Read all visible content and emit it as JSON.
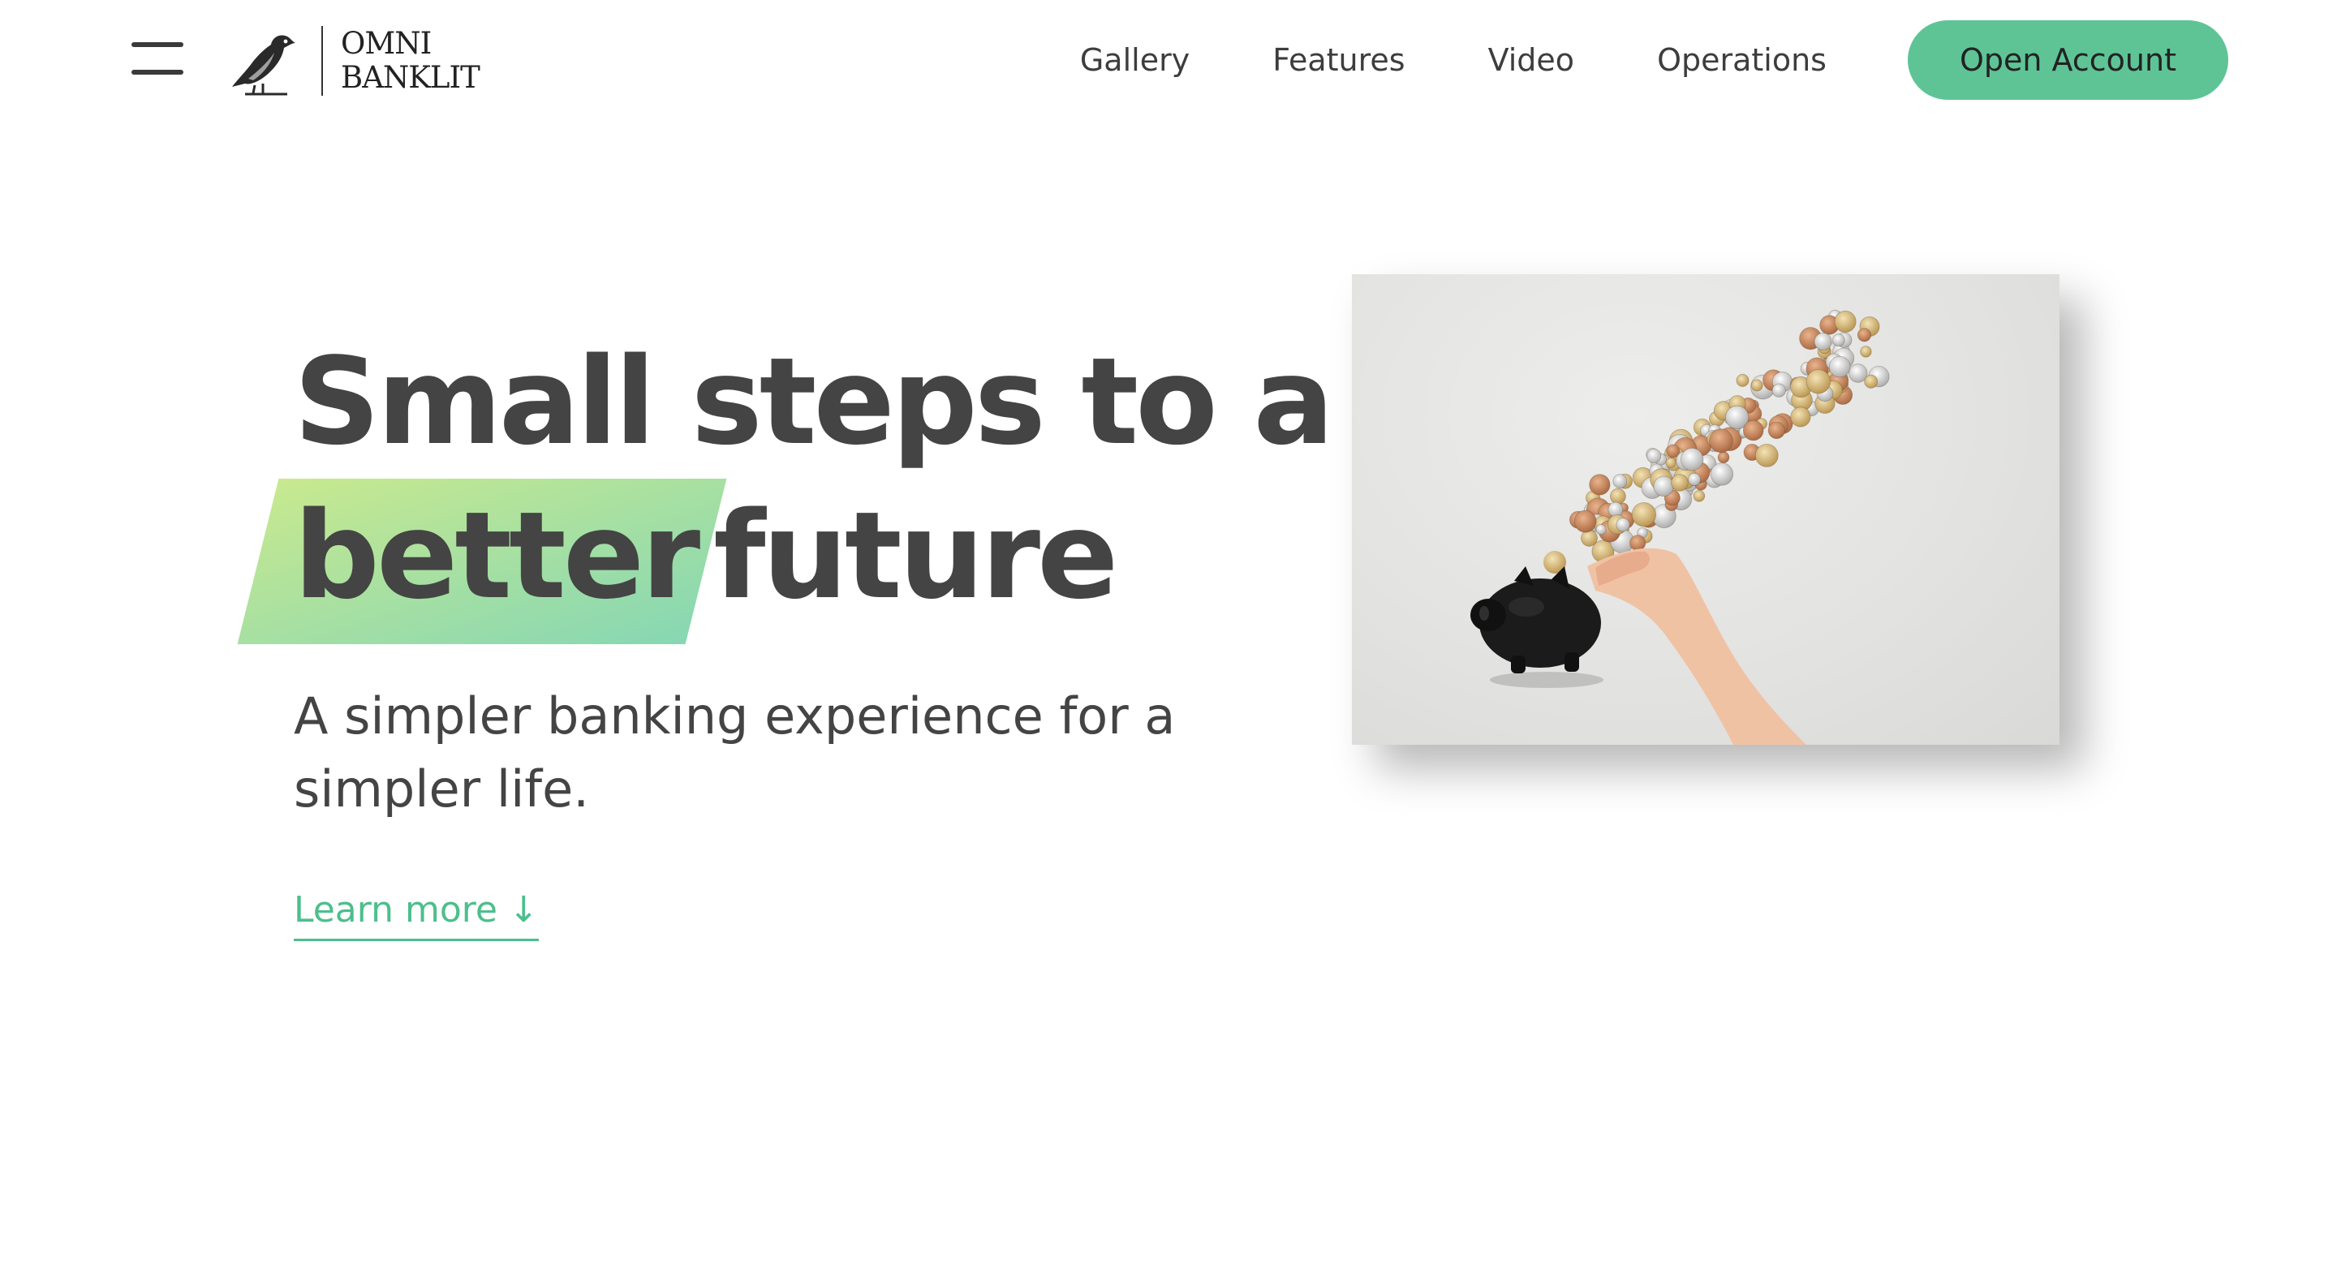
{
  "brand": {
    "line1": "OMNI",
    "line2": "BANKLIT"
  },
  "nav": {
    "items": [
      "Gallery",
      "Features",
      "Video",
      "Operations"
    ],
    "cta": "Open Account"
  },
  "hero": {
    "title_line1": "Small steps to a",
    "title_highlight": "better",
    "title_rest": "future",
    "subtitle": "A simpler banking experience for a simpler life.",
    "learn_more": "Learn more ↓"
  },
  "colors": {
    "accent": "#5ec496",
    "link": "#4cbf8c",
    "highlight_start": "#c8e98f",
    "highlight_end": "#86d7b4",
    "text": "#444444"
  },
  "icons": {
    "menu": "hamburger-menu-icon",
    "logo": "bird-logo-icon"
  }
}
